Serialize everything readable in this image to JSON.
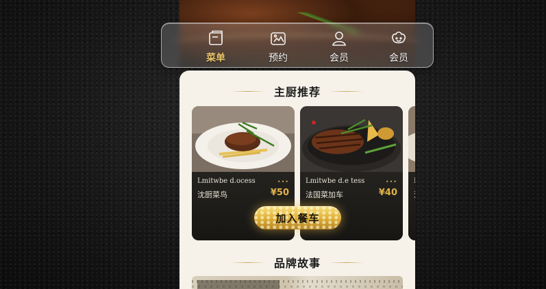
{
  "nav": {
    "items": [
      {
        "label": "菜单",
        "icon": "menu-book-icon",
        "active": true
      },
      {
        "label": "预约",
        "icon": "reservation-icon",
        "active": false
      },
      {
        "label": "会员",
        "icon": "member-icon",
        "active": false
      },
      {
        "label": "会员",
        "icon": "member-face-icon",
        "active": false
      }
    ]
  },
  "chef": {
    "title": "主厨推荐",
    "dishes": [
      {
        "en": "Lmitwbe d.ocess",
        "cn": "沈厨菜鸟",
        "price": "¥50",
        "rating": "•••"
      },
      {
        "en": "Lmitwbe d.e tess",
        "cn": "法国菜加车",
        "price": "¥40",
        "rating": "•••"
      },
      {
        "en": "Lo",
        "cn": "沛"
      }
    ],
    "add_to_cart": "加入餐车"
  },
  "story": {
    "title": "品牌故事"
  },
  "colors": {
    "accent_gold": "#e2b24a",
    "card_bg": "#f6f2ea",
    "dish_dark": "#1c1b1a"
  }
}
